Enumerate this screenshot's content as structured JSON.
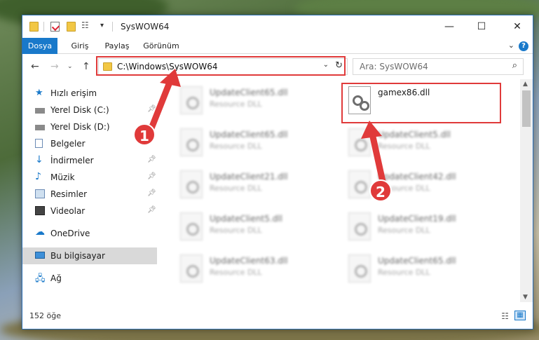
{
  "window": {
    "title": "SysWOW64"
  },
  "ribbon": {
    "tabs": [
      {
        "label": "Dosya",
        "active": true
      },
      {
        "label": "Giriş",
        "active": false
      },
      {
        "label": "Paylaş",
        "active": false
      },
      {
        "label": "Görünüm",
        "active": false
      }
    ]
  },
  "address": {
    "path": "C:\\Windows\\SysWOW64"
  },
  "search": {
    "placeholder": "Ara: SysWOW64"
  },
  "sidebar": {
    "items": [
      {
        "label": "Hızlı erişim",
        "icon": "star-icon"
      },
      {
        "label": "Yerel Disk (C:)",
        "icon": "drive-icon",
        "pinned": true
      },
      {
        "label": "Yerel Disk (D:)",
        "icon": "drive-icon"
      },
      {
        "label": "Belgeler",
        "icon": "documents-icon"
      },
      {
        "label": "İndirmeler",
        "icon": "download-icon",
        "pinned": true
      },
      {
        "label": "Müzik",
        "icon": "music-icon",
        "pinned": true
      },
      {
        "label": "Resimler",
        "icon": "pictures-icon",
        "pinned": true
      },
      {
        "label": "Videolar",
        "icon": "videos-icon",
        "pinned": true
      },
      {
        "label": "OneDrive",
        "icon": "cloud-icon"
      },
      {
        "label": "Bu bilgisayar",
        "icon": "computer-icon",
        "selected": true
      },
      {
        "label": "Ağ",
        "icon": "network-icon"
      }
    ]
  },
  "files": [
    {
      "name": "UpdateClient65.dll",
      "type": "Resource DLL"
    },
    {
      "name": "gamex86.dll",
      "type": ""
    },
    {
      "name": "UpdateClient65.dll",
      "type": "Resource DLL"
    },
    {
      "name": "UpdateClient5.dll",
      "type": "Resource DLL"
    },
    {
      "name": "UpdateClient21.dll",
      "type": "Resource DLL"
    },
    {
      "name": "UpdateClient42.dll",
      "type": "Resource DLL"
    },
    {
      "name": "UpdateClient5.dll",
      "type": "Resource DLL"
    },
    {
      "name": "UpdateClient19.dll",
      "type": "Resource DLL"
    },
    {
      "name": "UpdateClient63.dll",
      "type": "Resource DLL"
    },
    {
      "name": "UpdateClient65.dll",
      "type": "Resource DLL"
    }
  ],
  "status": {
    "item_count": "152 öğe"
  },
  "annotations": {
    "marker1": "1",
    "marker2": "2",
    "color": "#e03a3a"
  }
}
